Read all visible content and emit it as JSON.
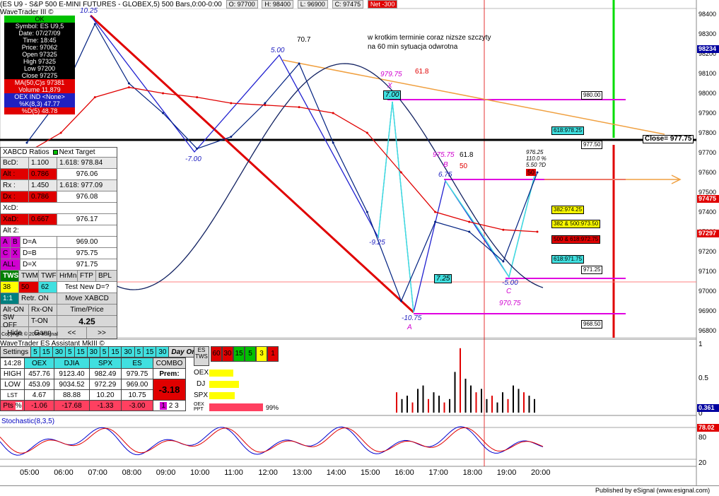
{
  "title_bar": {
    "symbol": "(ES U9 - S&P 500 E-MINI FUTURES - GLOBEX,5) 500 Bars,0:00-0:00",
    "open": "O: 97700",
    "high": "H: 98400",
    "low": "L: 96900",
    "close": "C: 97475",
    "net": "Net -300"
  },
  "app_name": "WaveTrader III ©",
  "info_panel": {
    "status": "OK",
    "symbol": "Symbol: ES U9,5",
    "date": "Date: 07/27/09",
    "time": "Time: 18:45",
    "price": "Price: 97062",
    "open": "Open 97325",
    "high": "High 97325",
    "low": "Low 97200",
    "close": "Close 97275",
    "ma": "MA(50,C)s 97381",
    "volume": "Volume 11,879",
    "oex": "OEX IND <None>",
    "pk": "%K(8,3) 47.77",
    "pd": "%D(5) 48.78"
  },
  "annotations": {
    "note_line1": "w krotkim terminie coraz nizsze szczyty",
    "note_line2": "na 60 min sytuacja odwrotna",
    "n_70_7": "70.7",
    "n_61_8_top": "61.8",
    "n_979_75": "979.75",
    "n_7_00": "7.00",
    "n_x": "X",
    "n_975_75": "975.75",
    "n_61_8_b": "61.8",
    "n_50": "50",
    "n_b": "B",
    "n_6_75": "6.75",
    "n_7_25": "7.25",
    "n_a": "A",
    "n_10_75": "-10.75",
    "n_9_25": "-9.25",
    "n_7_00_low": "-7.00",
    "n_10_25": "10.25",
    "n_5_00_top": "5.00",
    "n_5_00_c": "-5.00",
    "n_c": "C",
    "n_970_75": "970.75",
    "n_976_25": "976.25",
    "n_110": "110.0 %",
    "n_5_50": "5.50 ?D",
    "n_50_box": "50"
  },
  "price_levels": {
    "p980": "980.00",
    "p978_25": "618:978.25",
    "p977_50": "977.50",
    "close": "Close= 977.75",
    "p974_25": "382:974.25",
    "p973_50": "382 & 500:973.50",
    "p972_75": "500 & 618:972.75",
    "p971_75": "618:971.75",
    "p971_25": "971.25",
    "p968_50": "968.50"
  },
  "price_axis": [
    "98400",
    "98300",
    "98200",
    "98100",
    "98000",
    "97900",
    "97800",
    "97700",
    "97600",
    "97500",
    "97400",
    "97300",
    "97200",
    "97100",
    "97000",
    "96900",
    "96800"
  ],
  "price_badges": {
    "b98234": "98234",
    "b97475": "97475",
    "b97297": "97297"
  },
  "time_axis": [
    "05:00",
    "06:00",
    "07:00",
    "08:00",
    "09:00",
    "10:00",
    "11:00",
    "12:00",
    "13:00",
    "14:00",
    "15:00",
    "16:00",
    "17:00",
    "18:00",
    "19:00",
    "20:00"
  ],
  "xabcd": {
    "header": "XABCD Ratios",
    "next_target": "Next Target",
    "rows": [
      {
        "k": "BcD:",
        "v": "1.100",
        "t": "1.618: 978.84"
      },
      {
        "k": "Alt :",
        "v": "0.786",
        "t": "976.06"
      },
      {
        "k": "Rx :",
        "v": "1.450",
        "t": "1.618: 977.09"
      },
      {
        "k": "Dx :",
        "v": "0.786",
        "t": "976.08"
      }
    ],
    "xcd": "XcD:",
    "xad_k": "XaD:",
    "xad_v": "0.667",
    "xad_t": "976.17",
    "alt2": "Alt 2:",
    "da": "D=A",
    "da_v": "969.00",
    "db": "D=B",
    "db_v": "975.75",
    "dx": "D=X",
    "dx_v": "971.75",
    "btn_a": "A",
    "btn_b": "B",
    "btn_c": "C",
    "btn_x": "X",
    "btn_all": "ALL",
    "tws": "TWS",
    "twm": "TWM",
    "twf": "TWF",
    "hrmn": "HrMn",
    "ftp": "FTP",
    "bpl": "BPL",
    "n38": "38",
    "n50": "50",
    "n62": "62",
    "test_new": "Test New D=?",
    "r11": "1:1",
    "retr_on": "Retr. ON",
    "move_xabcd": "Move XABCD",
    "alt_on": "Alt-ON",
    "rx_on": "Rx-ON",
    "time_price": "Time/Price",
    "sw_off": "SW OFF",
    "t_on": "T-ON",
    "val_425": "4.25",
    "hide": "Hide",
    "gann": "Gann",
    "prev": "<<",
    "next": ">>",
    "copyright": "Copyright © 2006 eSignal"
  },
  "es_panel": {
    "title": "WaveTrader ES Assistant MkIII ©",
    "settings": "Settings",
    "tf": [
      "5",
      "15",
      "30",
      "5",
      "15",
      "30",
      "5",
      "15",
      "30",
      "5",
      "15",
      "30"
    ],
    "day_only": "Day Only",
    "es_tws": "ES TWS",
    "right_tf": [
      "60",
      "30",
      "15",
      "5",
      "3",
      "1"
    ],
    "time": "14:28",
    "cols": [
      "OEX",
      "DJIA",
      "SPX",
      "ES"
    ],
    "combo": "COMBO",
    "high": [
      "HIGH",
      "457.76",
      "9123.40",
      "982.49",
      "979.75"
    ],
    "prem": "Prem:",
    "low": [
      "LOW",
      "453.09",
      "9034.52",
      "972.29",
      "969.00"
    ],
    "prem_val": "-3.18",
    "lst": [
      "LST",
      "4.67",
      "88.88",
      "10.20",
      "10.75"
    ],
    "pts": [
      "Pts",
      "%",
      "-1.06",
      "-17.68",
      "-1.33",
      "-3.00"
    ],
    "bars": [
      "OEX",
      "DJ",
      "SPX",
      "OEX PPT"
    ],
    "pct": "99%",
    "b1": "1",
    "b2": "2",
    "b3": "3"
  },
  "volume_axis": [
    "1",
    "0.5",
    "0"
  ],
  "volume_badge": "0.361",
  "stochastic": {
    "label": "Stochastic(8,3,5)",
    "axis": [
      "80",
      "20"
    ],
    "badge": "78.02"
  },
  "footer": "Published by eSignal (www.esignal.com)",
  "chart_data": {
    "type": "line",
    "title": "(ES U9 - S&P 500 E-MINI FUTURES - GLOBEX,5) 500 Bars,0:00-0:00",
    "ylim": [
      96800,
      98400
    ],
    "x": [
      "05:00",
      "06:00",
      "07:00",
      "08:00",
      "09:00",
      "10:00",
      "11:00",
      "12:00",
      "13:00",
      "14:00",
      "15:00",
      "16:00",
      "17:00",
      "18:00",
      "19:00",
      "20:00"
    ],
    "series": [
      {
        "name": "ES U9 price",
        "values": [
          97750,
          97980,
          98350,
          98050,
          97900,
          97720,
          97780,
          97950,
          98150,
          97750,
          97400,
          96950,
          97350,
          97300,
          97150,
          97600
        ]
      },
      {
        "name": "MA(50,C)",
        "values": [
          97700,
          97800,
          97980,
          98030,
          98000,
          97980,
          97950,
          97940,
          97930,
          97900,
          97800,
          97600,
          97400,
          97350,
          97310,
          97300
        ]
      }
    ]
  }
}
